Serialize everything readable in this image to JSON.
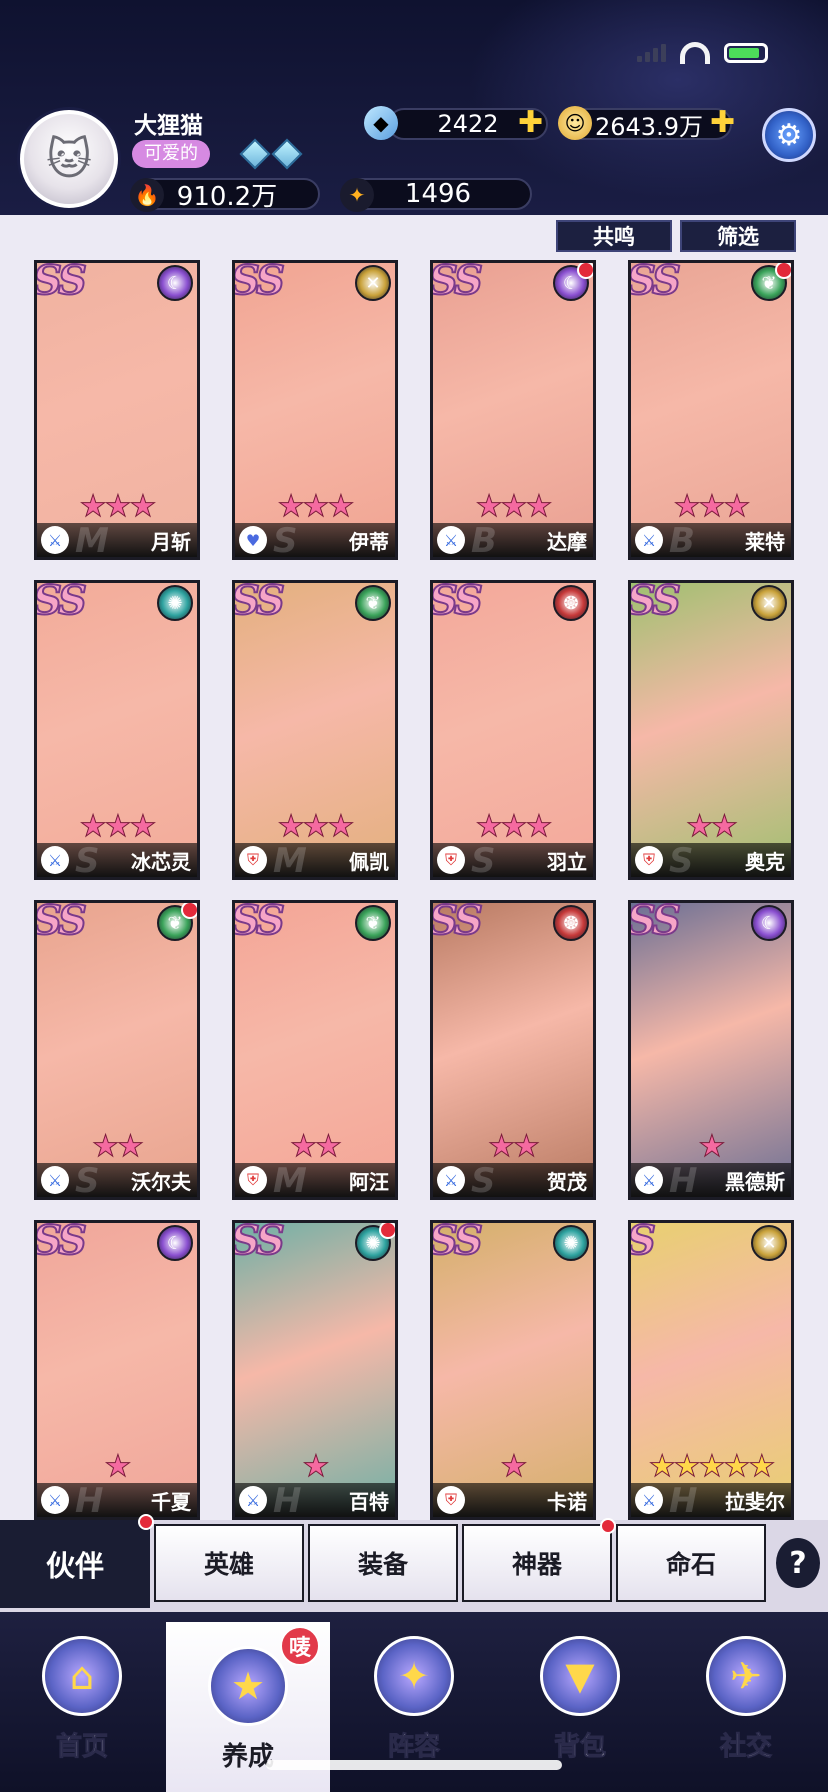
{
  "player": {
    "name": "大狸猫",
    "title": "可爱的",
    "power": "910.2万",
    "points": "1496"
  },
  "resources": {
    "diamonds": "2422",
    "gold": "2643.9万"
  },
  "filters": {
    "resonance": "共鸣",
    "filter": "筛选"
  },
  "colors": {
    "moon": "#8a4fd0",
    "nature": "#3aa35a",
    "abyss": "#2ea3a0",
    "order": "#c9a23a",
    "fire": "#c73a3a",
    "class_caster": "#3a6de0",
    "class_support": "#4a5ae0",
    "class_warrior": "#e0443a",
    "class_tank": "#e03a3a"
  },
  "heroes": [
    {
      "rank": "SS",
      "faction": "moon-icon",
      "stars": "★★★",
      "name": "月斩",
      "letter": "M",
      "class": "sword-icon",
      "art": "#f0b2a0",
      "badge": false
    },
    {
      "rank": "SS",
      "faction": "order-icon",
      "stars": "★★★",
      "name": "伊蒂",
      "letter": "S",
      "class": "heart-icon",
      "art": "#f1a492",
      "badge": false
    },
    {
      "rank": "SS",
      "faction": "moon-icon",
      "stars": "★★★",
      "name": "达摩",
      "letter": "B",
      "class": "sword-icon",
      "art": "#e9a092",
      "badge": true
    },
    {
      "rank": "SS",
      "faction": "nature-icon",
      "stars": "★★★",
      "name": "莱特",
      "letter": "B",
      "class": "sword-icon",
      "art": "#e9a595",
      "badge": true
    },
    {
      "rank": "SS",
      "faction": "abyss-icon",
      "stars": "★★★",
      "name": "冰芯灵",
      "letter": "S",
      "class": "sword-icon",
      "art": "#f2ab99",
      "badge": false
    },
    {
      "rank": "SS",
      "faction": "nature-icon",
      "stars": "★★★",
      "name": "佩凯",
      "letter": "M",
      "class": "shield-icon",
      "art": "#e3b07e",
      "badge": false
    },
    {
      "rank": "SS",
      "faction": "fire-icon",
      "stars": "★★★",
      "name": "羽立",
      "letter": "S",
      "class": "shield-icon",
      "art": "#f3a89a",
      "badge": false
    },
    {
      "rank": "SS",
      "faction": "order-icon",
      "stars": "★★",
      "name": "奥克",
      "letter": "S",
      "class": "shield-icon",
      "art": "#9fc070",
      "badge": false
    },
    {
      "rank": "SS",
      "faction": "nature-icon",
      "stars": "★★",
      "name": "沃尔夫",
      "letter": "S",
      "class": "sword-icon",
      "art": "#e8a48e",
      "badge": true
    },
    {
      "rank": "SS",
      "faction": "nature-icon",
      "stars": "★★",
      "name": "阿汪",
      "letter": "M",
      "class": "shield-icon",
      "art": "#f4a596",
      "badge": false
    },
    {
      "rank": "SS",
      "faction": "fire-icon",
      "stars": "★★",
      "name": "贺茂",
      "letter": "S",
      "class": "sword-icon",
      "art": "#b87a62",
      "badge": false
    },
    {
      "rank": "SS",
      "faction": "moon-icon",
      "stars": "★",
      "name": "黑德斯",
      "letter": "H",
      "class": "sword-icon",
      "art": "#6b6f94",
      "badge": false
    },
    {
      "rank": "SS",
      "faction": "moon-icon",
      "stars": "★",
      "name": "千夏",
      "letter": "H",
      "class": "sword-icon",
      "art": "#f0a69a",
      "badge": false
    },
    {
      "rank": "SS",
      "faction": "abyss-icon",
      "stars": "★",
      "name": "百特",
      "letter": "H",
      "class": "sword-icon",
      "art": "#6fb0a5",
      "badge": true
    },
    {
      "rank": "SS",
      "faction": "abyss-icon",
      "stars": "★",
      "name": "卡诺",
      "letter": "",
      "class": "shield-icon",
      "art": "#d4b06a",
      "badge": false
    },
    {
      "rank": "S",
      "faction": "order-icon",
      "stars": "★★★★★",
      "name": "拉斐尔",
      "letter": "H",
      "class": "sword-icon",
      "art": "#e8d070",
      "badge": false
    }
  ],
  "tabs": [
    {
      "label": "伙伴",
      "active": true,
      "badge": true
    },
    {
      "label": "英雄",
      "active": false,
      "badge": false
    },
    {
      "label": "装备",
      "active": false,
      "badge": false
    },
    {
      "label": "神器",
      "active": false,
      "badge": true
    },
    {
      "label": "命石",
      "active": false,
      "badge": false
    }
  ],
  "nav": [
    {
      "label": "首页",
      "icon": "castle-icon"
    },
    {
      "label": "养成",
      "icon": "star-triangle-icon",
      "badge": "唛"
    },
    {
      "label": "阵容",
      "icon": "formation-icon"
    },
    {
      "label": "背包",
      "icon": "bag-icon"
    },
    {
      "label": "社交",
      "icon": "chat-icon"
    }
  ]
}
